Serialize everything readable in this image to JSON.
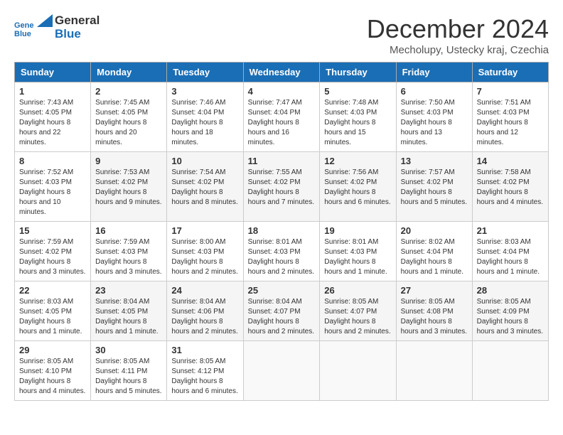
{
  "header": {
    "logo": {
      "line1": "General",
      "line2": "Blue"
    },
    "title": "December 2024",
    "subtitle": "Mecholupy, Ustecky kraj, Czechia"
  },
  "weekdays": [
    "Sunday",
    "Monday",
    "Tuesday",
    "Wednesday",
    "Thursday",
    "Friday",
    "Saturday"
  ],
  "weeks": [
    [
      {
        "day": "1",
        "sunrise": "7:43 AM",
        "sunset": "4:05 PM",
        "daylight": "8 hours and 22 minutes."
      },
      {
        "day": "2",
        "sunrise": "7:45 AM",
        "sunset": "4:05 PM",
        "daylight": "8 hours and 20 minutes."
      },
      {
        "day": "3",
        "sunrise": "7:46 AM",
        "sunset": "4:04 PM",
        "daylight": "8 hours and 18 minutes."
      },
      {
        "day": "4",
        "sunrise": "7:47 AM",
        "sunset": "4:04 PM",
        "daylight": "8 hours and 16 minutes."
      },
      {
        "day": "5",
        "sunrise": "7:48 AM",
        "sunset": "4:03 PM",
        "daylight": "8 hours and 15 minutes."
      },
      {
        "day": "6",
        "sunrise": "7:50 AM",
        "sunset": "4:03 PM",
        "daylight": "8 hours and 13 minutes."
      },
      {
        "day": "7",
        "sunrise": "7:51 AM",
        "sunset": "4:03 PM",
        "daylight": "8 hours and 12 minutes."
      }
    ],
    [
      {
        "day": "8",
        "sunrise": "7:52 AM",
        "sunset": "4:03 PM",
        "daylight": "8 hours and 10 minutes."
      },
      {
        "day": "9",
        "sunrise": "7:53 AM",
        "sunset": "4:02 PM",
        "daylight": "8 hours and 9 minutes."
      },
      {
        "day": "10",
        "sunrise": "7:54 AM",
        "sunset": "4:02 PM",
        "daylight": "8 hours and 8 minutes."
      },
      {
        "day": "11",
        "sunrise": "7:55 AM",
        "sunset": "4:02 PM",
        "daylight": "8 hours and 7 minutes."
      },
      {
        "day": "12",
        "sunrise": "7:56 AM",
        "sunset": "4:02 PM",
        "daylight": "8 hours and 6 minutes."
      },
      {
        "day": "13",
        "sunrise": "7:57 AM",
        "sunset": "4:02 PM",
        "daylight": "8 hours and 5 minutes."
      },
      {
        "day": "14",
        "sunrise": "7:58 AM",
        "sunset": "4:02 PM",
        "daylight": "8 hours and 4 minutes."
      }
    ],
    [
      {
        "day": "15",
        "sunrise": "7:59 AM",
        "sunset": "4:02 PM",
        "daylight": "8 hours and 3 minutes."
      },
      {
        "day": "16",
        "sunrise": "7:59 AM",
        "sunset": "4:03 PM",
        "daylight": "8 hours and 3 minutes."
      },
      {
        "day": "17",
        "sunrise": "8:00 AM",
        "sunset": "4:03 PM",
        "daylight": "8 hours and 2 minutes."
      },
      {
        "day": "18",
        "sunrise": "8:01 AM",
        "sunset": "4:03 PM",
        "daylight": "8 hours and 2 minutes."
      },
      {
        "day": "19",
        "sunrise": "8:01 AM",
        "sunset": "4:03 PM",
        "daylight": "8 hours and 1 minute."
      },
      {
        "day": "20",
        "sunrise": "8:02 AM",
        "sunset": "4:04 PM",
        "daylight": "8 hours and 1 minute."
      },
      {
        "day": "21",
        "sunrise": "8:03 AM",
        "sunset": "4:04 PM",
        "daylight": "8 hours and 1 minute."
      }
    ],
    [
      {
        "day": "22",
        "sunrise": "8:03 AM",
        "sunset": "4:05 PM",
        "daylight": "8 hours and 1 minute."
      },
      {
        "day": "23",
        "sunrise": "8:04 AM",
        "sunset": "4:05 PM",
        "daylight": "8 hours and 1 minute."
      },
      {
        "day": "24",
        "sunrise": "8:04 AM",
        "sunset": "4:06 PM",
        "daylight": "8 hours and 2 minutes."
      },
      {
        "day": "25",
        "sunrise": "8:04 AM",
        "sunset": "4:07 PM",
        "daylight": "8 hours and 2 minutes."
      },
      {
        "day": "26",
        "sunrise": "8:05 AM",
        "sunset": "4:07 PM",
        "daylight": "8 hours and 2 minutes."
      },
      {
        "day": "27",
        "sunrise": "8:05 AM",
        "sunset": "4:08 PM",
        "daylight": "8 hours and 3 minutes."
      },
      {
        "day": "28",
        "sunrise": "8:05 AM",
        "sunset": "4:09 PM",
        "daylight": "8 hours and 3 minutes."
      }
    ],
    [
      {
        "day": "29",
        "sunrise": "8:05 AM",
        "sunset": "4:10 PM",
        "daylight": "8 hours and 4 minutes."
      },
      {
        "day": "30",
        "sunrise": "8:05 AM",
        "sunset": "4:11 PM",
        "daylight": "8 hours and 5 minutes."
      },
      {
        "day": "31",
        "sunrise": "8:05 AM",
        "sunset": "4:12 PM",
        "daylight": "8 hours and 6 minutes."
      },
      null,
      null,
      null,
      null
    ]
  ],
  "labels": {
    "sunrise": "Sunrise:",
    "sunset": "Sunset:",
    "daylight": "Daylight hours"
  }
}
